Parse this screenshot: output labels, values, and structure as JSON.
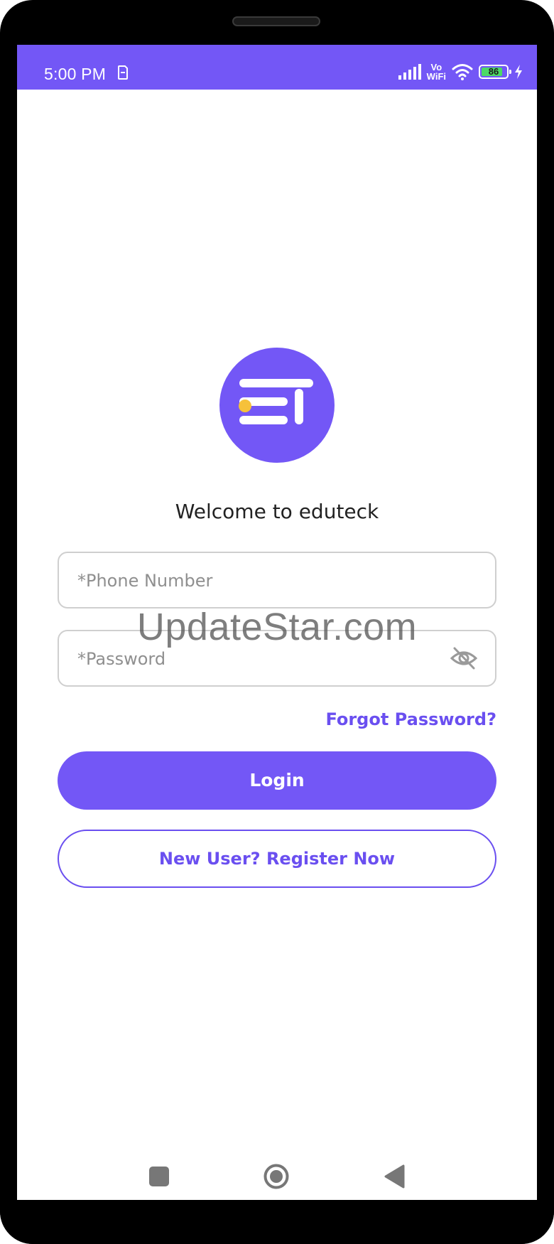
{
  "status_bar": {
    "time": "5:00 PM",
    "network_label_top": "Vo",
    "network_label_bottom": "WiFi",
    "battery_level": "86",
    "battery_fraction": 0.86
  },
  "app": {
    "welcome_text": "Welcome to eduteck",
    "phone_field": {
      "placeholder": "*Phone Number",
      "value": ""
    },
    "password_field": {
      "placeholder": "*Password",
      "value": ""
    },
    "forgot_password": "Forgot Password?",
    "login_button": "Login",
    "register_button": "New User? Register Now"
  },
  "watermark": "UpdateStar.com",
  "colors": {
    "accent": "#7357f6",
    "link": "#6a4ff0",
    "logo_dot": "#f6c13a",
    "battery_green": "#4cd964"
  },
  "icons": {
    "status_left": "sim-card-icon",
    "signal": "signal-bars-icon",
    "wifi": "wifi-icon",
    "battery": "battery-icon",
    "charging": "lightning-icon",
    "password_toggle": "eye-off-icon",
    "nav_recent": "square-icon",
    "nav_home": "circle-icon",
    "nav_back": "triangle-back-icon"
  }
}
